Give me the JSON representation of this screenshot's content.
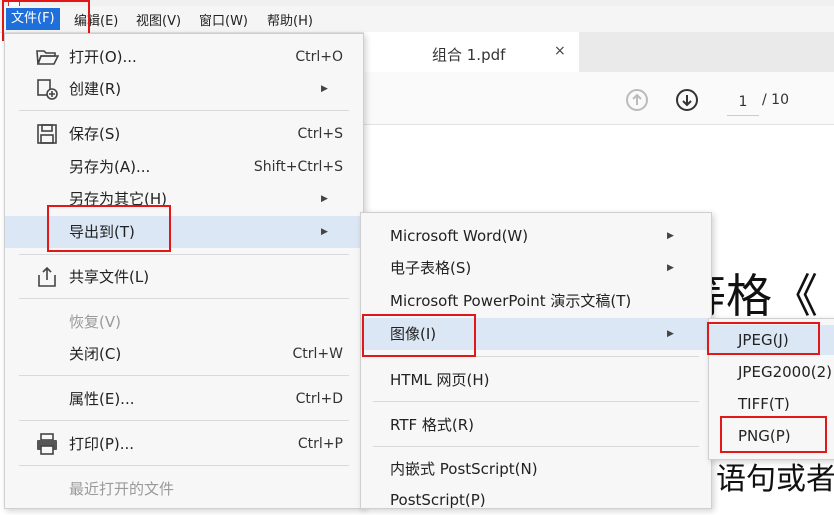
{
  "menubar": {
    "items": [
      "文件(F)",
      "编辑(E)",
      "视图(V)",
      "窗口(W)",
      "帮助(H)"
    ]
  },
  "document": {
    "tab_label": "组合 1.pdf",
    "tab_close": "×",
    "page_current": "1",
    "page_total": "/ 10",
    "text_line1": "等格《",
    "text_line2": "语句或者"
  },
  "file_menu": {
    "open": {
      "label": "打开(O)...",
      "shortcut": "Ctrl+O"
    },
    "create": {
      "label": "创建(R)"
    },
    "save": {
      "label": "保存(S)",
      "shortcut": "Ctrl+S"
    },
    "save_as": {
      "label": "另存为(A)...",
      "shortcut": "Shift+Ctrl+S"
    },
    "save_as_other": {
      "label": "另存为其它(H)"
    },
    "export_to": {
      "label": "导出到(T)"
    },
    "share": {
      "label": "共享文件(L)"
    },
    "revert": {
      "label": "恢复(V)"
    },
    "close": {
      "label": "关闭(C)",
      "shortcut": "Ctrl+W"
    },
    "properties": {
      "label": "属性(E)...",
      "shortcut": "Ctrl+D"
    },
    "print": {
      "label": "打印(P)...",
      "shortcut": "Ctrl+P"
    },
    "recent": {
      "label": "最近打开的文件"
    }
  },
  "export_menu": {
    "word": "Microsoft Word(W)",
    "spreadsheet": "电子表格(S)",
    "powerpoint": "Microsoft PowerPoint 演示文稿(T)",
    "image": "图像(I)",
    "html": "HTML 网页(H)",
    "rtf": "RTF 格式(R)",
    "embedded_ps": "内嵌式 PostScript(N)",
    "postscript": "PostScript(P)"
  },
  "image_menu": {
    "jpeg": "JPEG(J)",
    "jpeg2000": "JPEG2000(2)",
    "tiff": "TIFF(T)",
    "png": "PNG(P)"
  },
  "colors": {
    "highlight": "#dbe7f5",
    "annotation_red": "#e01818",
    "menubar_active": "#1e6fd9"
  }
}
